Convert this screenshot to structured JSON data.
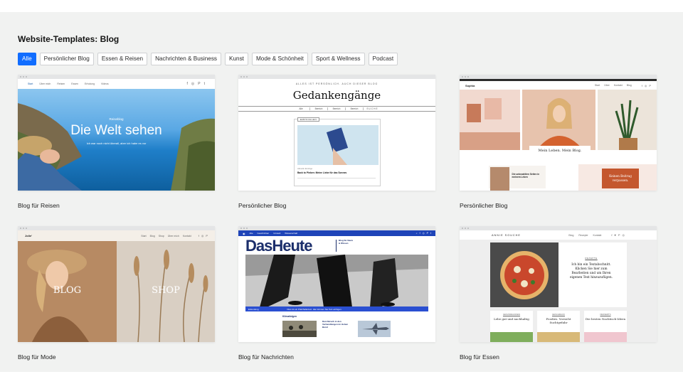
{
  "heading": "Website-Templates: Blog",
  "filters": [
    {
      "label": "Alle",
      "active": true
    },
    {
      "label": "Persönlicher Blog",
      "active": false
    },
    {
      "label": "Essen & Reisen",
      "active": false
    },
    {
      "label": "Nachrichten & Business",
      "active": false
    },
    {
      "label": "Kunst",
      "active": false
    },
    {
      "label": "Mode & Schönheit",
      "active": false
    },
    {
      "label": "Sport & Wellness",
      "active": false
    },
    {
      "label": "Podcast",
      "active": false
    }
  ],
  "colors": {
    "accent": "#116dff",
    "page_bg": "#f1f2f1"
  },
  "templates": [
    {
      "caption": "Blog für Reisen",
      "nav": [
        "Start",
        "Über mich",
        "Reisen",
        "Essen",
        "Erholung",
        "Videos"
      ],
      "tag": "Reiseblog",
      "title": "Die Welt sehen",
      "subtitle": "Ich war noch nicht überall, aber ich habe es vor",
      "social": [
        "f",
        "◎",
        "P",
        "t"
      ]
    },
    {
      "caption": "Persönlicher Blog",
      "kicker": "ALLES IST PERSÖNLICH. AUCH DIESER BLOG",
      "title": "Gedankengänge",
      "menu": [
        "Alle",
        "Bereich",
        "Bereich",
        "Bereich"
      ],
      "menu_right": "SUCHE",
      "featured": "EMPFOHLEN",
      "post_title": "Back to Pinken: Meine Liebe für das Sonnes",
      "post_meta": "Aktuelle Einträge"
    },
    {
      "caption": "Persönlicher Blog",
      "brand": "Sophia",
      "nav": [
        "Start",
        "Über",
        "Kontakt",
        "Blog"
      ],
      "title": "Mein Leben. Mein Blog.",
      "post_title": "Die unbezahlten Seiten in meinem Leben",
      "cta": "Keinen Beitrag verpassen.",
      "social": [
        "f",
        "◎",
        "P"
      ]
    },
    {
      "caption": "Blog für Mode",
      "brand": "Jolie'",
      "nav": [
        "Start",
        "Blog",
        "Shop",
        "Über mich",
        "Kontakt"
      ],
      "left_label": "BLOG",
      "right_label": "SHOP",
      "social": [
        "f",
        "◎",
        "P"
      ]
    },
    {
      "caption": "Blog für Nachrichten",
      "nav": [
        "Alle",
        "Geschichten",
        "Umwelt",
        "Wissenschaft"
      ],
      "title": "DasHeute",
      "side_text": "Blog für News & Wissen",
      "bar_left": "Erkundung",
      "bar_text": "Dies ist ein Platzhaltertext. Hier können Sie Text einfügen.",
      "section": "Klimafolgen",
      "post_title": "Durchbruch in den Verhandlungen im Hohen Bund",
      "social": [
        "⌕",
        "f",
        "◎",
        "P",
        "t"
      ]
    },
    {
      "caption": "Blog für Essen",
      "brand": "ANNIE SOUCHE",
      "nav": [
        "Blog",
        "Rezepte",
        "Kontakt"
      ],
      "tag": "REZEPTE",
      "title": "Ich bin ein Textabschnitt. Klicken Sie hier zum Bearbeiten und um Ihren eigenen Text hinzuzufügen.",
      "cards": [
        {
          "tag": "GESUNDE ESSEN",
          "title": "Lebe gut und nachhaltig"
        },
        {
          "tag": "GESCHMACK",
          "title": "Foodies. Vorsicht Suchtgefahr"
        },
        {
          "tag": "DESSERTS",
          "title": "Die besten Nachtisch-Ideen"
        }
      ],
      "social": [
        "f",
        "♥",
        "P",
        "◎"
      ]
    }
  ]
}
